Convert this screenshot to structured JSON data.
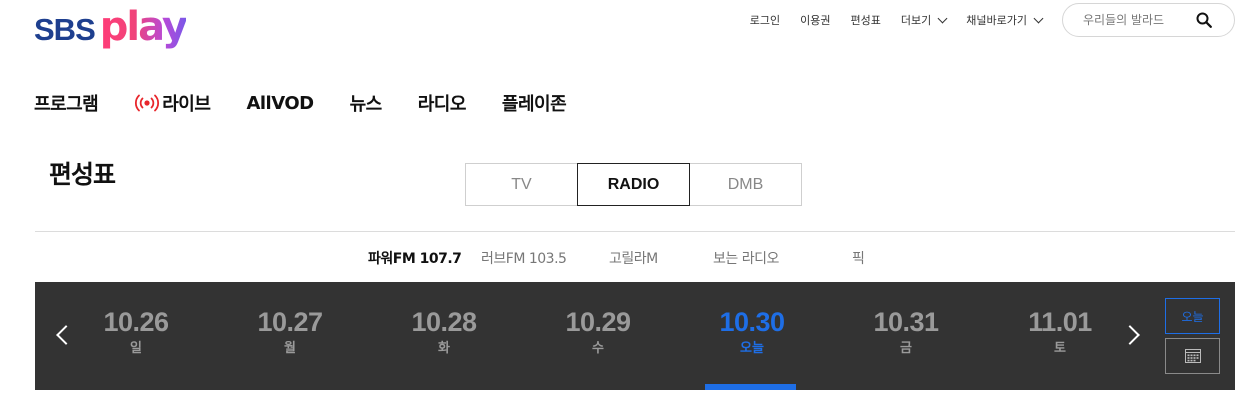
{
  "header": {
    "logo_sbs": "SBS",
    "logo_play": "play",
    "util_nav": [
      {
        "label": "로그인"
      },
      {
        "label": "이용권"
      },
      {
        "label": "편성표"
      },
      {
        "label": "더보기"
      },
      {
        "label": "채널바로가기"
      }
    ],
    "search_placeholder": "우리들의 발라드"
  },
  "gnb": [
    {
      "label": "프로그램"
    },
    {
      "label": "라이브"
    },
    {
      "label": "AllVOD"
    },
    {
      "label": "뉴스"
    },
    {
      "label": "라디오"
    },
    {
      "label": "플레이존"
    }
  ],
  "page_title": "편성표",
  "media_tabs": [
    {
      "label": "TV",
      "active": false
    },
    {
      "label": "RADIO",
      "active": true
    },
    {
      "label": "DMB",
      "active": false
    }
  ],
  "channels": [
    {
      "label": "파워FM 107.7",
      "active": true
    },
    {
      "label": "러브FM 103.5",
      "active": false
    },
    {
      "label": "고릴라M",
      "active": false
    },
    {
      "label": "보는 라디오",
      "active": false
    },
    {
      "label": "픽",
      "active": false
    }
  ],
  "dates": [
    {
      "date": "10.26",
      "day": "일",
      "active": false
    },
    {
      "date": "10.27",
      "day": "월",
      "active": false
    },
    {
      "date": "10.28",
      "day": "화",
      "active": false
    },
    {
      "date": "10.29",
      "day": "수",
      "active": false
    },
    {
      "date": "10.30",
      "day": "오늘",
      "active": true
    },
    {
      "date": "10.31",
      "day": "금",
      "active": false
    },
    {
      "date": "11.01",
      "day": "토",
      "active": false
    }
  ],
  "today_button": "오늘",
  "colors": {
    "accent": "#1e6ee6",
    "date_bar_bg": "#333333",
    "live_red": "#e8262c",
    "logo_navy": "#1e3f8f"
  }
}
